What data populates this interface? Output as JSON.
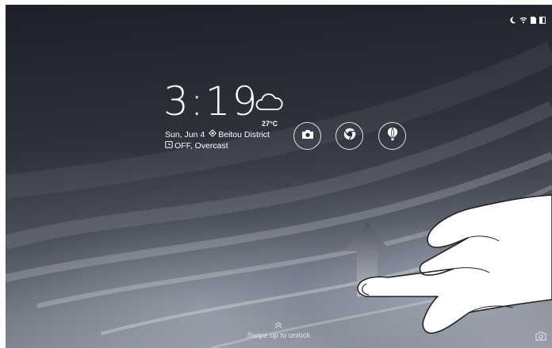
{
  "status_bar": {
    "icons": [
      "moon-icon",
      "wifi-icon",
      "sim-icon",
      "battery-icon"
    ]
  },
  "lockscreen": {
    "time": "3:19",
    "weather": {
      "icon": "cloud-icon",
      "temperature": "27°C",
      "condition": "Overcast"
    },
    "date": "Sun, Jun 4",
    "location": "Beitou District",
    "alarm": "OFF",
    "alarm_weather_line": "OFF, Overcast",
    "shortcuts": [
      {
        "icon": "camera-icon"
      },
      {
        "icon": "chrome-icon"
      },
      {
        "icon": "balloon-icon"
      }
    ],
    "unlock_hint": "Swipe up to unlock",
    "corner_icon": "camera-icon"
  },
  "gesture_overlay": {
    "type": "swipe-up",
    "arrow_icon": "up-arrow-icon",
    "hand_icon": "pointing-hand-icon"
  },
  "colors": {
    "text": "#ffffff",
    "wallpaper_dark": "#1d2027",
    "wallpaper_light": "#a3a7b1"
  }
}
